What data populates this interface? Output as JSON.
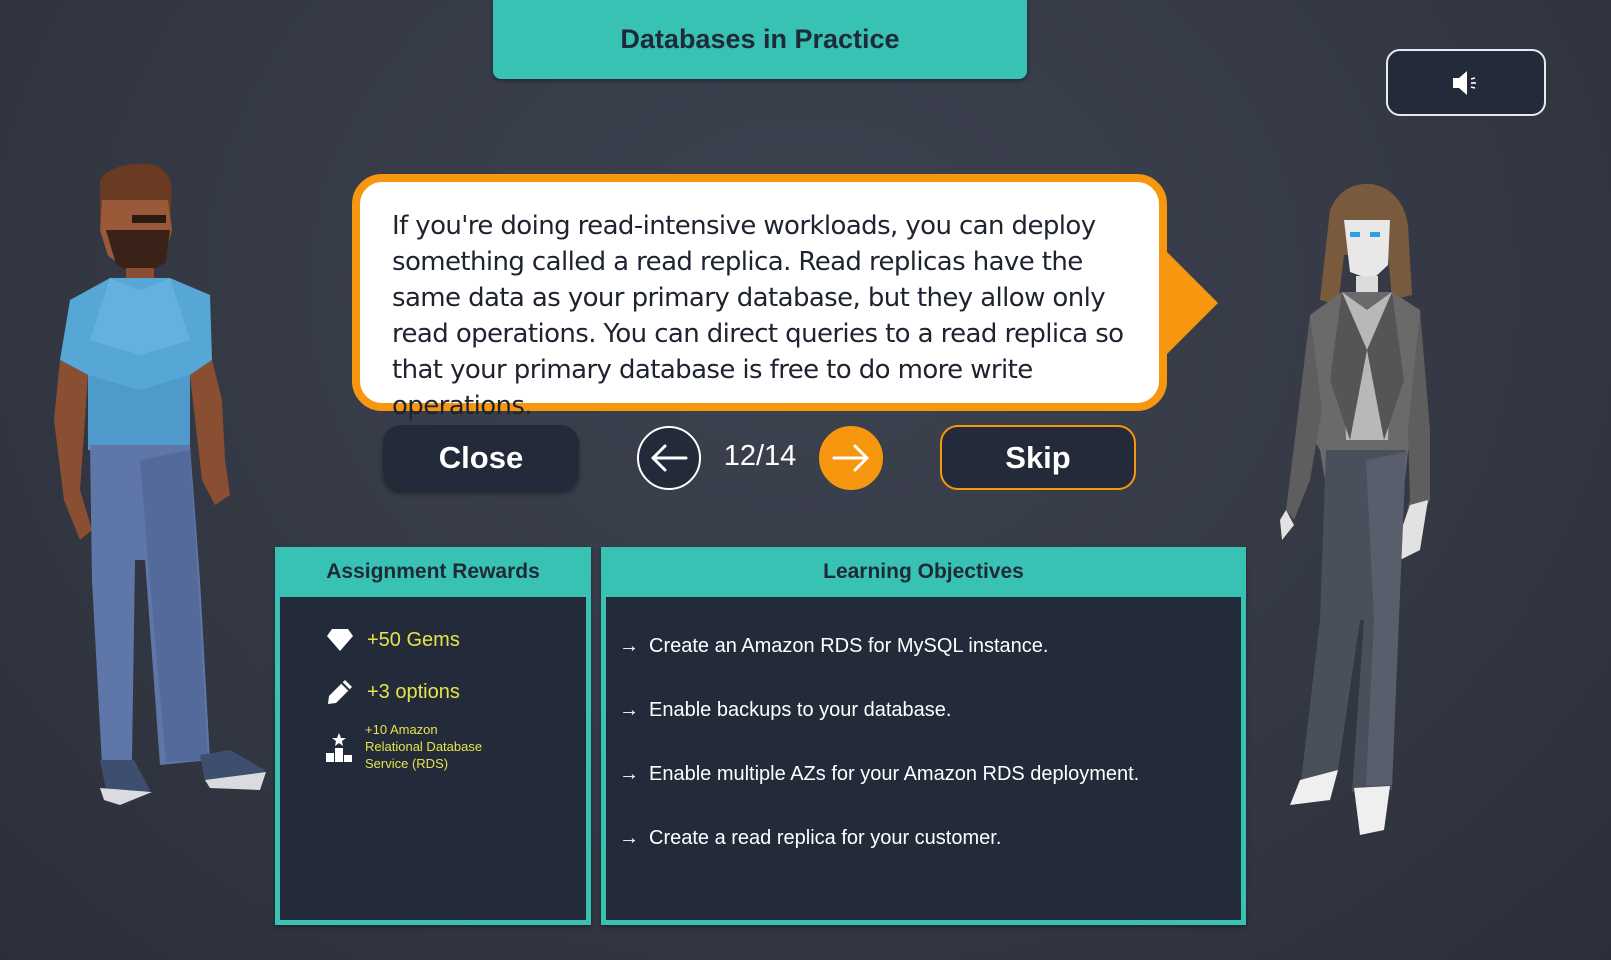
{
  "header": {
    "title": "Databases in Practice"
  },
  "sound_button": {
    "icon": "speaker-icon"
  },
  "dialog": {
    "text": "If you're doing read-intensive workloads, you can deploy something called a read replica. Read replicas have the same data as your primary database, but they allow only read operations. You can direct queries to a read replica so that your primary database is free to do more write operations."
  },
  "controls": {
    "close_label": "Close",
    "skip_label": "Skip",
    "page": "12/14",
    "prev_icon": "arrow-left-icon",
    "next_icon": "arrow-right-icon"
  },
  "rewards": {
    "title": "Assignment Rewards",
    "items": [
      {
        "icon": "gem-icon",
        "label": "+50 Gems"
      },
      {
        "icon": "pencil-icon",
        "label": "+3 options"
      },
      {
        "icon": "leaderboard-icon",
        "label": "+10 Amazon Relational Database Service (RDS)"
      }
    ]
  },
  "objectives": {
    "title": "Learning Objectives",
    "items": [
      "Create an Amazon RDS for MySQL instance.",
      "Enable backups to your database.",
      "Enable multiple AZs for your Amazon RDS deployment.",
      "Create a read replica for your customer."
    ]
  },
  "colors": {
    "teal": "#37c2b3",
    "orange": "#f7960f",
    "navy": "#232b3a",
    "reward_text": "#e8e34a"
  }
}
